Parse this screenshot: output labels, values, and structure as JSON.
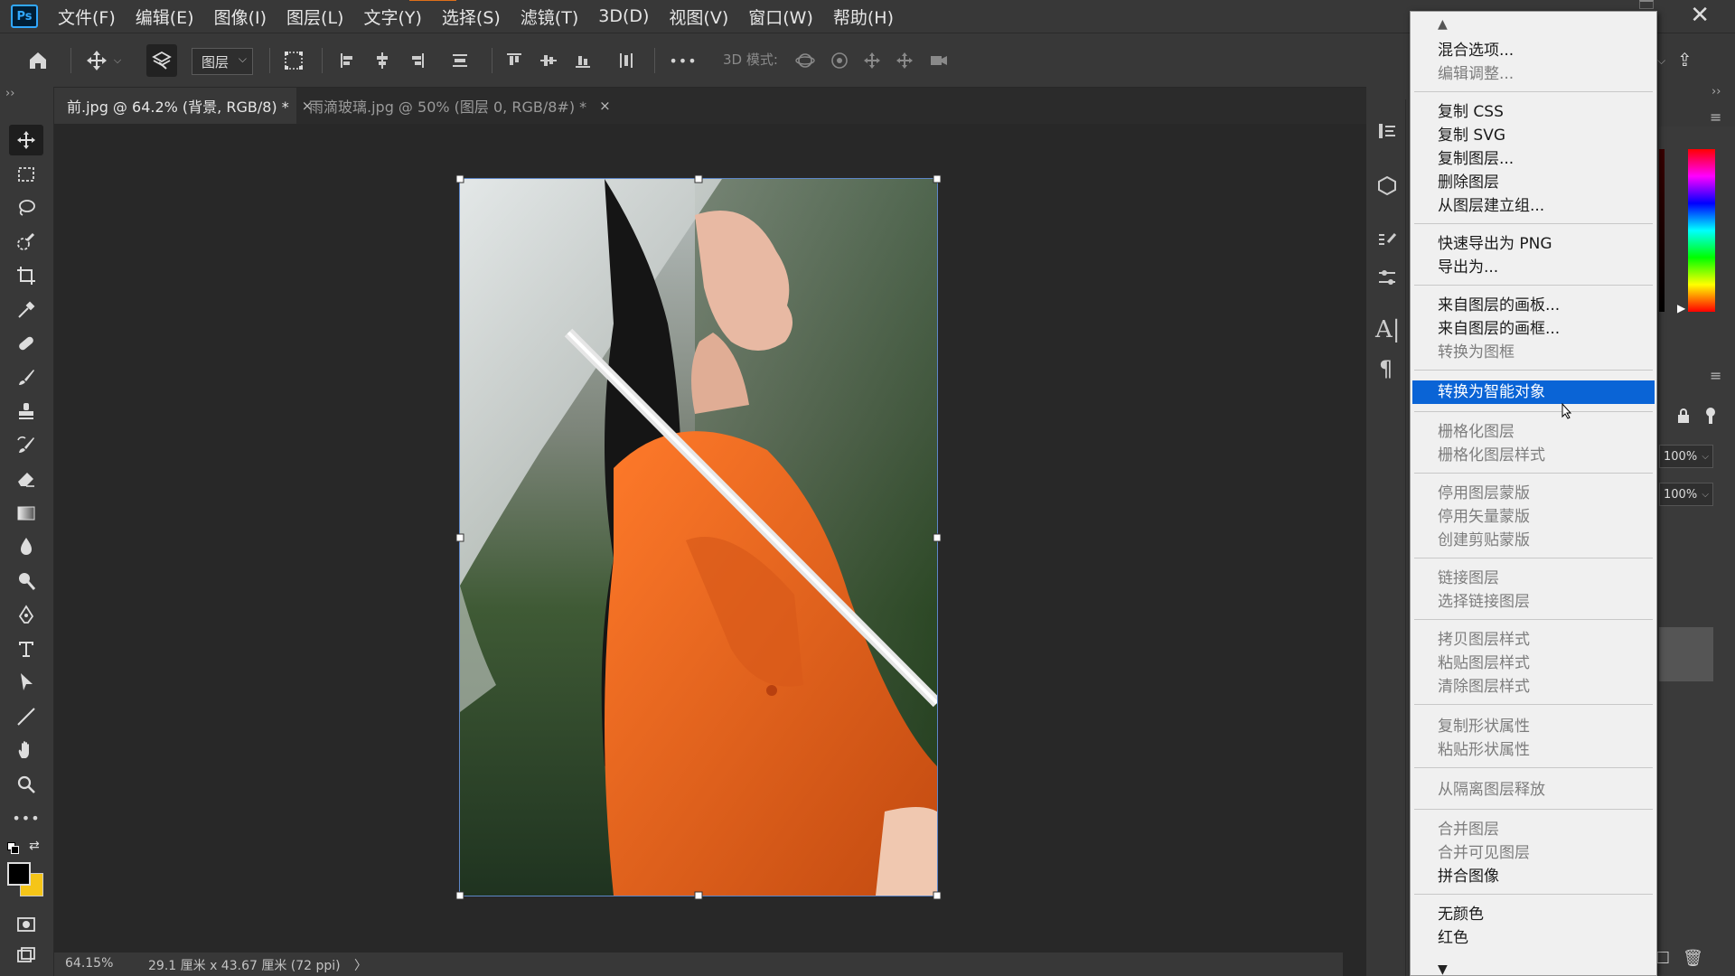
{
  "app": {
    "logo": "Ps"
  },
  "menubar": {
    "items": [
      "文件(F)",
      "编辑(E)",
      "图像(I)",
      "图层(L)",
      "文字(Y)",
      "选择(S)",
      "滤镜(T)",
      "3D(D)",
      "视图(V)",
      "窗口(W)",
      "帮助(H)"
    ]
  },
  "optionsbar": {
    "layer_select": "图层",
    "mode_3d_label": "3D 模式:",
    "more": "•••"
  },
  "tabs": [
    {
      "label": "前.jpg @ 64.2% (背景, RGB/8) *",
      "close": "×"
    },
    {
      "label": "雨滴玻璃.jpg @ 50% (图层 0, RGB/8#) *",
      "close": "×"
    }
  ],
  "statusbar": {
    "zoom": "64.15%",
    "doc_size": "29.1 厘米 x 43.67 厘米 (72 ppi)",
    "arrow": "〉"
  },
  "rightpanel": {
    "opacity": "100%",
    "fill": "100%"
  },
  "context_menu": {
    "items": [
      {
        "label": "混合选项...",
        "disabled": false
      },
      {
        "label": "编辑调整...",
        "disabled": true
      },
      {
        "label": "复制 CSS",
        "disabled": false
      },
      {
        "label": "复制 SVG",
        "disabled": false
      },
      {
        "label": "复制图层...",
        "disabled": false
      },
      {
        "label": "删除图层",
        "disabled": false
      },
      {
        "label": "从图层建立组...",
        "disabled": false
      },
      {
        "label": "快速导出为 PNG",
        "disabled": false
      },
      {
        "label": "导出为...",
        "disabled": false
      },
      {
        "label": "来自图层的画板...",
        "disabled": false
      },
      {
        "label": "来自图层的画框...",
        "disabled": false
      },
      {
        "label": "转换为图框",
        "disabled": true
      },
      {
        "label": "转换为智能对象",
        "disabled": false,
        "highlighted": true
      },
      {
        "label": "栅格化图层",
        "disabled": true
      },
      {
        "label": "栅格化图层样式",
        "disabled": true
      },
      {
        "label": "停用图层蒙版",
        "disabled": true
      },
      {
        "label": "停用矢量蒙版",
        "disabled": true
      },
      {
        "label": "创建剪贴蒙版",
        "disabled": true
      },
      {
        "label": "链接图层",
        "disabled": true
      },
      {
        "label": "选择链接图层",
        "disabled": true
      },
      {
        "label": "拷贝图层样式",
        "disabled": true
      },
      {
        "label": "粘贴图层样式",
        "disabled": true
      },
      {
        "label": "清除图层样式",
        "disabled": true
      },
      {
        "label": "复制形状属性",
        "disabled": true
      },
      {
        "label": "粘贴形状属性",
        "disabled": true
      },
      {
        "label": "从隔离图层释放",
        "disabled": true
      },
      {
        "label": "合并图层",
        "disabled": true
      },
      {
        "label": "合并可见图层",
        "disabled": true
      },
      {
        "label": "拼合图像",
        "disabled": false
      },
      {
        "label": "无颜色",
        "disabled": false
      },
      {
        "label": "红色",
        "disabled": false
      }
    ]
  },
  "colors": {
    "accent_highlight": "#0a64d6",
    "active_menu_underline": "#e0701a",
    "foreground_swatch": "#000000",
    "background_swatch": "#f5c518"
  },
  "tools": [
    "move-tool",
    "marquee-tool",
    "lasso-tool",
    "quick-select-tool",
    "crop-tool",
    "eyedropper-tool",
    "healing-brush-tool",
    "brush-tool",
    "clone-stamp-tool",
    "history-brush-tool",
    "eraser-tool",
    "gradient-tool",
    "blur-tool",
    "dodge-tool",
    "pen-tool",
    "type-tool",
    "path-select-tool",
    "line-tool",
    "hand-tool",
    "zoom-tool",
    "more-tools"
  ]
}
